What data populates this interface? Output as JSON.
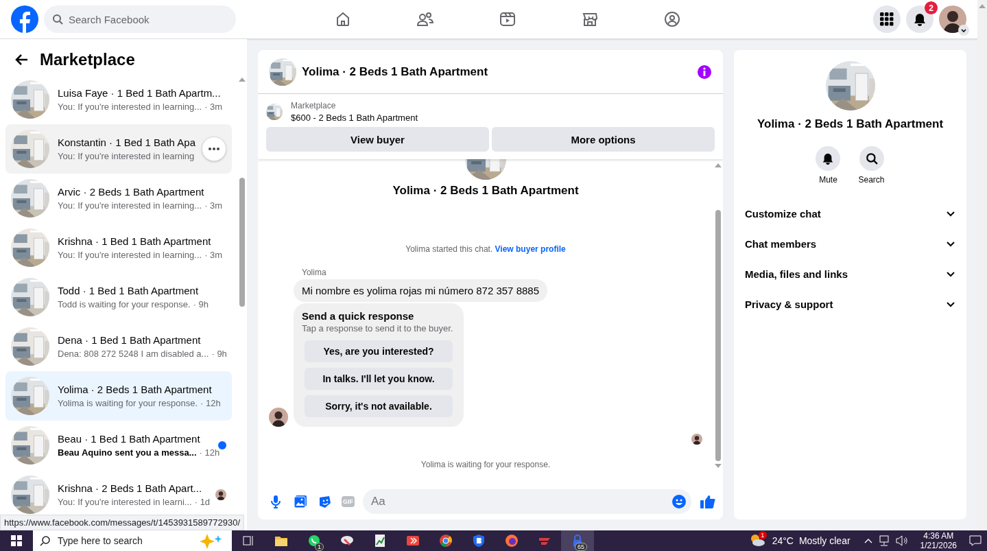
{
  "topbar": {
    "search": {
      "placeholder": "Search Facebook"
    },
    "notifications_badge": "2"
  },
  "sidebar": {
    "title": "Marketplace",
    "conversations": [
      {
        "title": "Luisa Faye · 1 Bed 1 Bath Apartm...",
        "preview": "You: If you're interested in learning...",
        "time": "· 3m",
        "selected": false,
        "hovered": false,
        "unread": false,
        "read_receipt": false
      },
      {
        "title": "Konstantin · 1 Bed 1 Bath Apa",
        "preview": "You: If you're interested in learning",
        "selected": false,
        "hovered": true,
        "unread": false,
        "read_receipt": false
      },
      {
        "title": "Arvic · 2 Beds 1 Bath Apartment",
        "preview": "You: If you're interested in learning...",
        "time": "· 3m",
        "selected": false,
        "hovered": false,
        "unread": false,
        "read_receipt": false
      },
      {
        "title": "Krishna · 1 Bed 1 Bath Apartment",
        "preview": "You: If you're interested in learning...",
        "time": "· 3m",
        "selected": false,
        "hovered": false,
        "unread": false,
        "read_receipt": false
      },
      {
        "title": "Todd · 1 Bed 1 Bath Apartment",
        "preview": "Todd is waiting for your response.",
        "time": "· 9h",
        "selected": false,
        "hovered": false,
        "unread": false,
        "read_receipt": false
      },
      {
        "title": "Dena · 1 Bed 1 Bath Apartment",
        "preview": "Dena: 808 272 5248 I am disabled a...",
        "time": "· 9h",
        "selected": false,
        "hovered": false,
        "unread": false,
        "read_receipt": false
      },
      {
        "title": "Yolima · 2 Beds 1 Bath Apartment",
        "preview": "Yolima is waiting for your response.",
        "time": "· 12h",
        "selected": true,
        "hovered": false,
        "unread": false,
        "read_receipt": false
      },
      {
        "title": "Beau · 1 Bed 1 Bath Apartment",
        "preview": "Beau Aquino sent you a messa...",
        "time": "· 12h",
        "selected": false,
        "hovered": false,
        "unread": true,
        "read_receipt": false
      },
      {
        "title": "Krishna · 2 Beds 1 Bath Apart...",
        "preview": "You: If you're interested in learni...",
        "time": "· 1d",
        "selected": false,
        "hovered": false,
        "unread": false,
        "read_receipt": true
      }
    ]
  },
  "chat": {
    "title": "Yolima · 2 Beds 1 Bath Apartment",
    "listing": {
      "label": "Marketplace",
      "name": "$600 - 2 Beds 1 Bath Apartment"
    },
    "buttons": [
      "View buyer",
      "More options"
    ],
    "intro_title": "Yolima · 2 Beds 1 Bath Apartment",
    "intro_text": "Yolima started this chat.",
    "intro_link": "View buyer profile",
    "sender": "Yolima",
    "message": "Mi nombre es yolima rojas mi número 872 357 8885",
    "quick_response": {
      "title": "Send a quick response",
      "subtitle": "Tap a response to send it to the buyer.",
      "options": [
        "Yes, are you interested?",
        "In talks. I'll let you know.",
        "Sorry, it's not available."
      ]
    },
    "status": "Yolima is waiting for your response.",
    "composer": {
      "gif": "GIF",
      "placeholder": "Aa"
    }
  },
  "details": {
    "title": "Yolima · 2 Beds 1 Bath Apartment",
    "actions": [
      {
        "kind": "mute",
        "label": "Mute"
      },
      {
        "kind": "search",
        "label": "Search"
      }
    ],
    "sections": [
      {
        "label": "Customize chat",
        "expanded": false
      },
      {
        "label": "Chat members",
        "expanded": false
      },
      {
        "label": "Media, files and links",
        "expanded": false
      },
      {
        "label": "Privacy & support",
        "expanded": false
      }
    ]
  },
  "status_url": "https://www.facebook.com/messages/t/1453931589772930/",
  "taskbar": {
    "search": {
      "placeholder": "Type here to search"
    },
    "apps": [
      {
        "kind": "folder",
        "selected": false
      },
      {
        "kind": "chat",
        "badge": "1",
        "selected": false
      },
      {
        "kind": "paint",
        "selected": false
      },
      {
        "kind": "chart",
        "selected": false
      },
      {
        "kind": "remote",
        "selected": false
      },
      {
        "kind": "browser",
        "selected": false
      },
      {
        "kind": "shield",
        "selected": false
      },
      {
        "kind": "fox",
        "selected": false
      },
      {
        "kind": "express",
        "selected": false
      },
      {
        "kind": "lock",
        "badge": "65",
        "selected": true
      }
    ],
    "weather": {
      "badge": "1",
      "temperature": "24°C",
      "condition": "Mostly clear"
    },
    "time": "4:36 AM",
    "date": "1/21/2026"
  }
}
